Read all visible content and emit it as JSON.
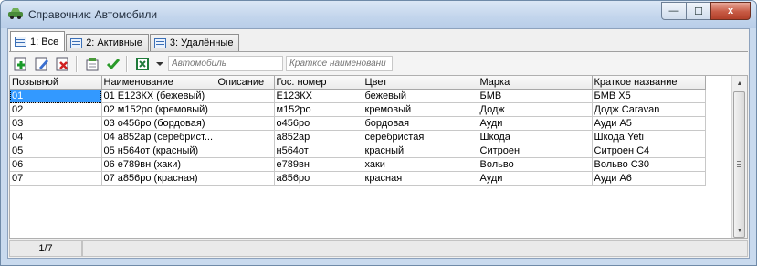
{
  "window": {
    "title": "Справочник: Автомобили",
    "close_label": "x",
    "minimize_label": "—",
    "maximize_label": "☐"
  },
  "tabs": [
    {
      "label": "1: Все",
      "active": true
    },
    {
      "label": "2: Активные",
      "active": false
    },
    {
      "label": "3: Удалённые",
      "active": false
    }
  ],
  "toolbar": {
    "filter_car_placeholder": "Автомобиль",
    "filter_short_placeholder": "Краткое наименовани",
    "buttons": [
      "add-record-icon",
      "edit-record-icon",
      "delete-record-icon",
      "properties-icon",
      "confirm-check-icon",
      "excel-export-icon",
      "dropdown-arrow-icon"
    ]
  },
  "table": {
    "columns": [
      "Позывной",
      "Наименование",
      "Описание",
      "Гос. номер",
      "Цвет",
      "Марка",
      "Краткое название"
    ],
    "rows": [
      [
        "01",
        "01 Е123КХ (бежевый)",
        "",
        "Е123КХ",
        "бежевый",
        "БМВ",
        "БМВ Х5"
      ],
      [
        "02",
        "02 м152ро (кремовый)",
        "",
        "м152ро",
        "кремовый",
        "Додж",
        "Додж Caravan"
      ],
      [
        "03",
        "03 о456ро (бордовая)",
        "",
        "о456ро",
        "бордовая",
        "Ауди",
        "Ауди А5"
      ],
      [
        "04",
        "04 а852ар (серебрист...",
        "",
        "а852ар",
        "серебристая",
        "Шкода",
        "Шкода Yeti"
      ],
      [
        "05",
        "05 н564от (красный)",
        "",
        "н564от",
        "красный",
        "Ситроен",
        "Ситроен С4"
      ],
      [
        "06",
        "06 е789вн (хаки)",
        "",
        "е789вн",
        "хаки",
        "Вольво",
        "Вольво С30"
      ],
      [
        "07",
        "07 а856ро (красная)",
        "",
        "а856ро",
        "красная",
        "Ауди",
        "Ауди А6"
      ]
    ]
  },
  "status": {
    "record_position": "1/7"
  },
  "colors": {
    "selection": "#3399ff",
    "close_button": "#c75a44",
    "title_bar": "#c2d5ec"
  }
}
